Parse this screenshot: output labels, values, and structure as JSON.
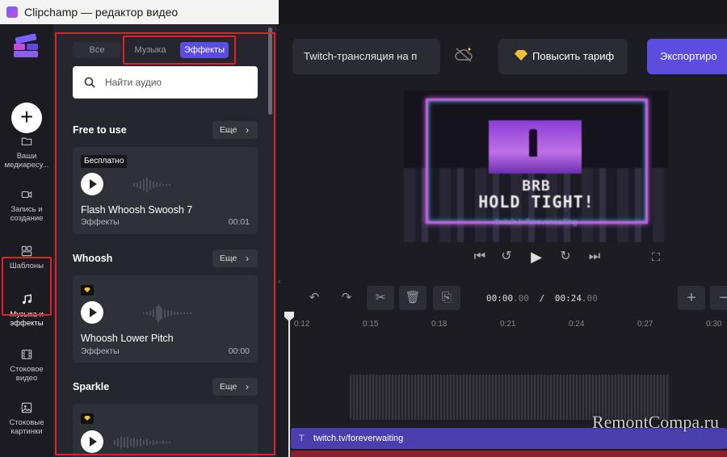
{
  "window": {
    "title": "Clipchamp — редактор видео"
  },
  "leftnav": {
    "items": [
      {
        "label": "Ваши медиаресу...",
        "icon": "folder-icon"
      },
      {
        "label": "Запись и создание",
        "icon": "camera-icon"
      },
      {
        "label": "Шаблоны",
        "icon": "templates-icon"
      },
      {
        "label": "Музыка и эффекты",
        "icon": "music-note-icon",
        "active": true
      },
      {
        "label": "Стоковое видео",
        "icon": "film-icon"
      },
      {
        "label": "Стоковые картинки",
        "icon": "image-icon"
      }
    ]
  },
  "panel": {
    "tabs": {
      "all": "Все",
      "music": "Музыка",
      "effects": "Эффекты"
    },
    "search": {
      "placeholder": "Найти аудио"
    },
    "more_label": "Еще",
    "sections": [
      {
        "title": "Free to use",
        "card": {
          "badge": "Бесплатно",
          "title": "Flash Whoosh Swoosh 7",
          "category": "Эффекты",
          "duration": "00:01"
        }
      },
      {
        "title": "Whoosh",
        "card": {
          "badge": "premium",
          "title": "Whoosh Lower Pitch",
          "category": "Эффекты",
          "duration": "00:00"
        }
      },
      {
        "title": "Sparkle",
        "card": {
          "badge": "premium"
        }
      }
    ]
  },
  "header": {
    "project_name": "Twitch-трансляция на п",
    "upgrade_label": "Повысить тариф",
    "export_label": "Экспортиро"
  },
  "preview": {
    "line1": "BRB",
    "line2": "HOLD TIGHT!",
    "url": "twitch.tv/foreverwaiting"
  },
  "timeline": {
    "time_current": "00:00",
    "time_current_frac": ".00",
    "time_total": "00:24",
    "time_total_frac": ".00",
    "ruler": [
      "0:12",
      "0:15",
      "0:18",
      "0:21",
      "0:24",
      "0:27",
      "0:30"
    ],
    "text_clip": "twitch.tv/foreverwaiting"
  },
  "watermark": "RemontCompa.ru",
  "colors": {
    "accent": "#5b4de0",
    "highlight": "#e0202a",
    "gem": "#f0c23a"
  }
}
